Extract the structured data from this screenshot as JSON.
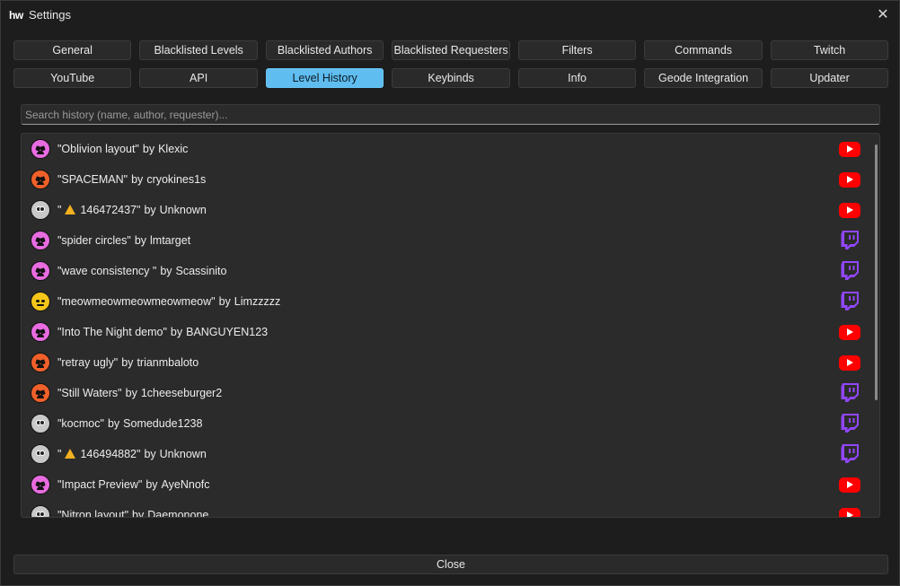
{
  "window": {
    "app_logo": "hw",
    "title": "Settings",
    "close_glyph": "✕"
  },
  "tabs": [
    {
      "label": "General",
      "active": false
    },
    {
      "label": "Blacklisted Levels",
      "active": false
    },
    {
      "label": "Blacklisted Authors",
      "active": false
    },
    {
      "label": "Blacklisted Requesters",
      "active": false
    },
    {
      "label": "Filters",
      "active": false
    },
    {
      "label": "Commands",
      "active": false
    },
    {
      "label": "Twitch",
      "active": false
    },
    {
      "label": "YouTube",
      "active": false
    },
    {
      "label": "API",
      "active": false
    },
    {
      "label": "Level History",
      "active": true
    },
    {
      "label": "Keybinds",
      "active": false
    },
    {
      "label": "Info",
      "active": false
    },
    {
      "label": "Geode Integration",
      "active": false
    },
    {
      "label": "Updater",
      "active": false
    }
  ],
  "search": {
    "placeholder": "Search history (name, author, requester)...",
    "value": ""
  },
  "history": [
    {
      "name_prefix": "\"Oblivion layout\"",
      "warn": false,
      "name_suffix": "",
      "author": "Klexic",
      "difficulty": "demon",
      "platform": "youtube"
    },
    {
      "name_prefix": "\"SPACEMAN\"",
      "warn": false,
      "name_suffix": "",
      "author": "cryokines1s",
      "difficulty": "insane",
      "platform": "youtube"
    },
    {
      "name_prefix": "\"",
      "warn": true,
      "name_suffix": "146472437\"",
      "author": "Unknown",
      "difficulty": "na",
      "platform": "youtube"
    },
    {
      "name_prefix": "\"spider circles\"",
      "warn": false,
      "name_suffix": "",
      "author": "lmtarget",
      "difficulty": "demon",
      "platform": "twitch"
    },
    {
      "name_prefix": "\"wave consistency \"",
      "warn": false,
      "name_suffix": "",
      "author": "Scassinito",
      "difficulty": "demon",
      "platform": "twitch"
    },
    {
      "name_prefix": "\"meowmeowmeowmeowmeow\"",
      "warn": false,
      "name_suffix": "",
      "author": "Limzzzzz",
      "difficulty": "easy",
      "platform": "twitch"
    },
    {
      "name_prefix": "\"Into The Night demo\"",
      "warn": false,
      "name_suffix": "",
      "author": "BANGUYEN123",
      "difficulty": "demon",
      "platform": "youtube"
    },
    {
      "name_prefix": "\"retray ugly\"",
      "warn": false,
      "name_suffix": "",
      "author": "trianmbaloto",
      "difficulty": "insane",
      "platform": "youtube"
    },
    {
      "name_prefix": "\"Still Waters\"",
      "warn": false,
      "name_suffix": "",
      "author": "1cheeseburger2",
      "difficulty": "insane",
      "platform": "twitch"
    },
    {
      "name_prefix": "\"kocmoc\"",
      "warn": false,
      "name_suffix": "",
      "author": "Somedude1238",
      "difficulty": "na",
      "platform": "twitch"
    },
    {
      "name_prefix": "\"",
      "warn": true,
      "name_suffix": "146494882\"",
      "author": "Unknown",
      "difficulty": "na",
      "platform": "twitch"
    },
    {
      "name_prefix": "\"Impact Preview\"",
      "warn": false,
      "name_suffix": "",
      "author": "AyeNnofc",
      "difficulty": "demon",
      "platform": "youtube"
    },
    {
      "name_prefix": "\"Nitron layout\"",
      "warn": false,
      "name_suffix": "",
      "author": "Daemonone",
      "difficulty": "na",
      "platform": "youtube"
    }
  ],
  "by_word": "by",
  "difficulty_colors": {
    "demon": "#e86be0",
    "insane": "#f0602a",
    "easy": "#f5c518",
    "na": "#c8c8c8"
  },
  "platform_colors": {
    "youtube": "#ff0000",
    "twitch": "#9146ff"
  },
  "footer": {
    "close_label": "Close"
  }
}
